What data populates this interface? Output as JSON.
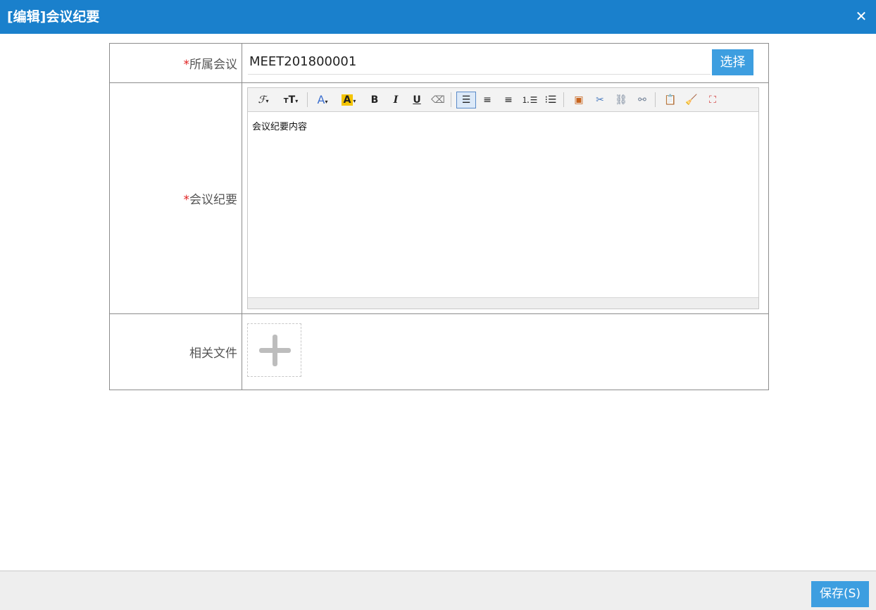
{
  "window": {
    "title": "[编辑]会议纪要",
    "close_icon": "close-icon"
  },
  "form": {
    "meeting": {
      "label": "所属会议",
      "required_mark": "*",
      "value": "MEET201800001",
      "select_label": "选择"
    },
    "minutes": {
      "label": "会议纪要",
      "required_mark": "*",
      "content": "会议纪要内容",
      "toolbar": [
        "font-family-icon",
        "font-size-icon",
        "font-color-icon",
        "highlight-color-icon",
        "bold-icon",
        "italic-icon",
        "underline-icon",
        "eraser-icon",
        "align-left-icon",
        "align-center-icon",
        "align-right-icon",
        "ordered-list-icon",
        "unordered-list-icon",
        "insert-image-icon",
        "cut-icon",
        "link-icon",
        "unlink-icon",
        "paste-icon",
        "clear-format-icon",
        "fullscreen-icon"
      ]
    },
    "files": {
      "label": "相关文件",
      "upload_icon": "plus-icon"
    }
  },
  "footer": {
    "save_label": "保存(S)"
  },
  "colors": {
    "titlebar": "#1a80cc",
    "button": "#3d9ee0",
    "required": "#e02020"
  }
}
